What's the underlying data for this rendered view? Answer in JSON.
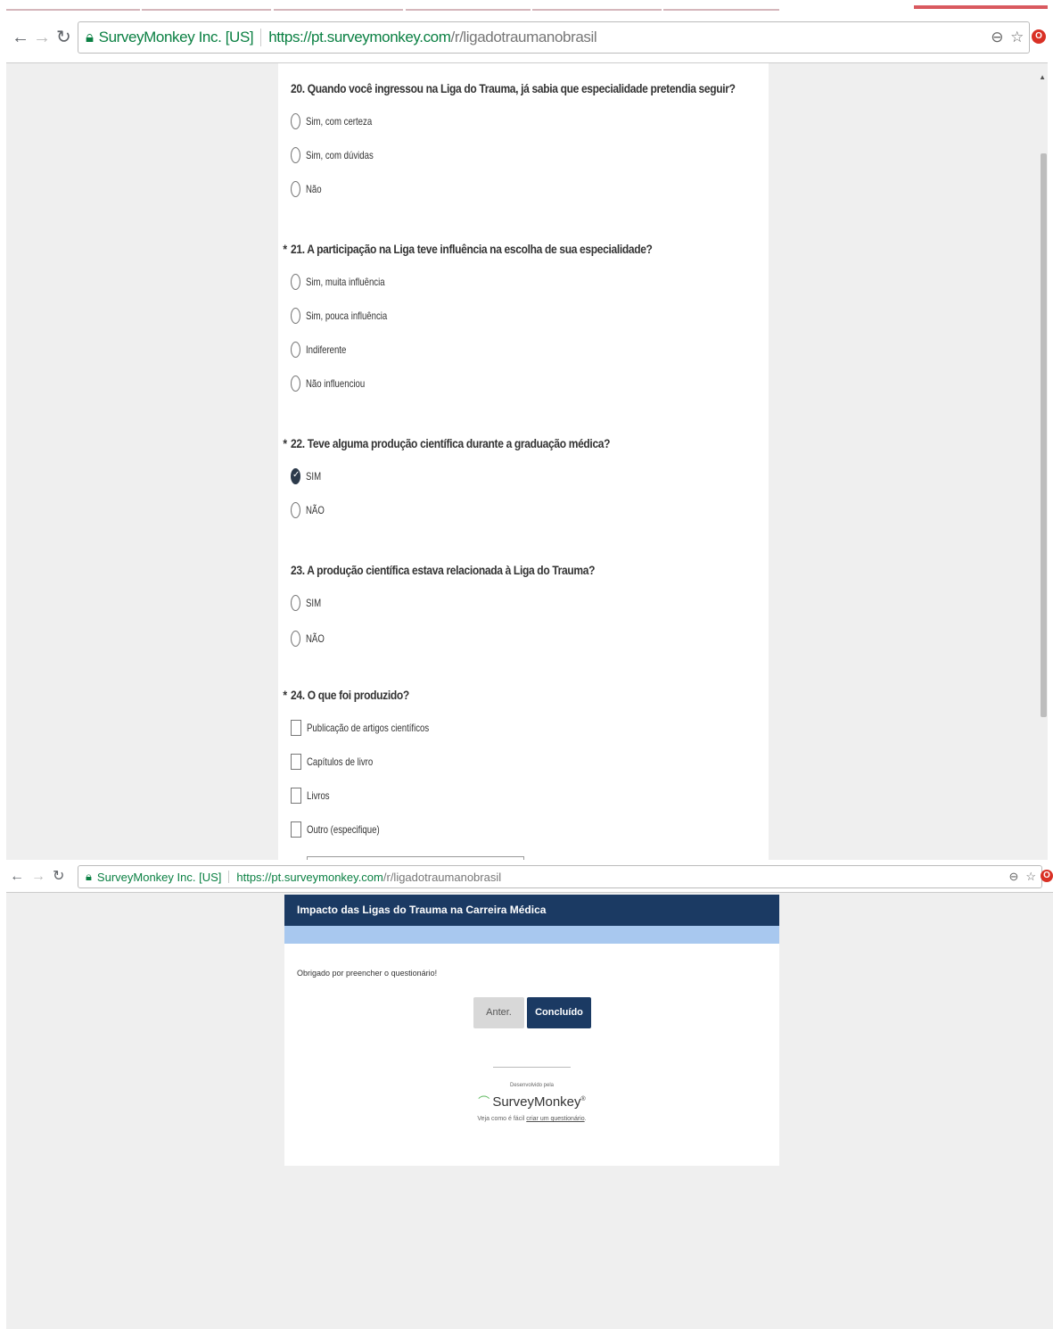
{
  "browser": {
    "site_label": "SurveyMonkey Inc. [US]",
    "url_host": "https://pt.surveymonkey.com",
    "url_path": "/r/ligadotraumanobrasil",
    "icons": [
      "back-arrow-icon",
      "forward-arrow-icon",
      "reload-icon",
      "lock-icon",
      "zoom-icon",
      "star-icon",
      "opera-icon"
    ]
  },
  "survey_page": {
    "questions": [
      {
        "label": "20. Quando você ingressou na Liga do Trauma, já sabia que especialidade pretendia seguir?",
        "required": false,
        "type": "radio",
        "options": [
          "Sim, com certeza",
          "Sim, com dúvidas",
          "Não"
        ],
        "selected": null
      },
      {
        "label": "21. A participação na Liga teve influência na escolha de sua especialidade?",
        "required": true,
        "type": "radio",
        "options": [
          "Sim, muita influência",
          "Sim, pouca influência",
          "Indiferente",
          "Não influenciou"
        ],
        "selected": null
      },
      {
        "label": "22. Teve alguma produção científica durante a graduação médica?",
        "required": true,
        "type": "radio",
        "options": [
          "SIM",
          "NÃO"
        ],
        "selected": 0
      },
      {
        "label": "23. A produção científica estava relacionada à Liga do Trauma?",
        "required": false,
        "type": "radio",
        "options": [
          "SIM",
          "NÃO"
        ],
        "selected": null
      },
      {
        "label": "24. O que foi produzido?",
        "required": true,
        "type": "checkbox",
        "options": [
          "Publicação de artigos científicos",
          "Capítulos de livro",
          "Livros",
          "Outro (especifique)"
        ],
        "selected": null
      }
    ],
    "required_marker": "*"
  },
  "end_page": {
    "header_title": "Impacto das Ligas do Trauma na Carreira Médica",
    "thanks_text": "Obrigado por preencher o questionário!",
    "prev_button": "Anter.",
    "done_button": "Concluído",
    "powered_by": "Desenvolvido pela",
    "brand": "SurveyMonkey",
    "cta_prefix": "Veja como é fácil ",
    "cta_link": "criar um questionário",
    "cta_suffix": "."
  }
}
